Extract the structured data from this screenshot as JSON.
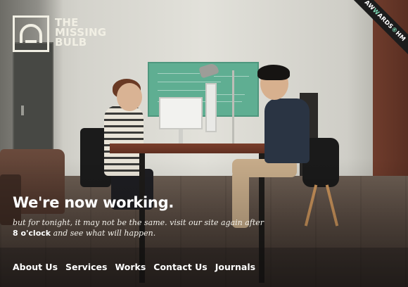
{
  "brand": {
    "line1": "The",
    "line2": "Missing",
    "line3": "Bulb"
  },
  "award_ribbon": {
    "pre": "AW",
    "highlight": "W",
    "mid": "ARDS",
    "sym": "®",
    "post": "HM"
  },
  "hero": {
    "headline": "We're now working.",
    "subtext_part1": "but for tonight, it may not be the same. visit our site again after",
    "time": "8 o'clock",
    "subtext_part2": "and see what will happen."
  },
  "nav": {
    "items": [
      {
        "label": "About Us"
      },
      {
        "label": "Services"
      },
      {
        "label": "Works"
      },
      {
        "label": "Contact Us"
      },
      {
        "label": "Journals"
      }
    ]
  },
  "colors": {
    "text_light": "#f1efe4",
    "ribbon_bg": "#1c1c1c",
    "ribbon_accent": "#7ed6b4",
    "chalkboard": "#5fae92"
  },
  "icons": [
    "bulb-logo-icon"
  ]
}
